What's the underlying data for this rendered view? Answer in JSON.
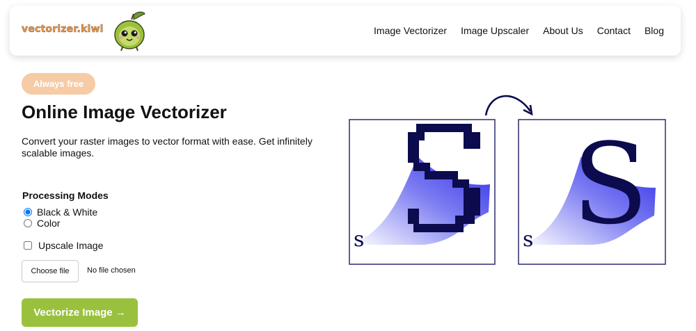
{
  "brand": {
    "logo_text": "vectorizer.kiwi",
    "mascot_icon": "kiwi-mascot-icon"
  },
  "nav": {
    "links": [
      "Image Vectorizer",
      "Image Upscaler",
      "About Us",
      "Contact",
      "Blog"
    ]
  },
  "hero": {
    "badge": "Always free",
    "title": "Online Image Vectorizer",
    "description": "Convert your raster images to vector format with ease. Get infinitely scalable images."
  },
  "form": {
    "modes_title": "Processing Modes",
    "modes": [
      {
        "label": "Black & White",
        "selected": true
      },
      {
        "label": "Color",
        "selected": false
      }
    ],
    "upscale_label": "Upscale Image",
    "upscale_checked": false,
    "file_button": "Choose file",
    "file_status": "No file chosen",
    "submit": "Vectorize Image →"
  },
  "illustration": {
    "big_letter": "S",
    "small_letter": "s",
    "raster_icon": "pixelated-s-icon",
    "vector_icon": "smooth-s-icon",
    "arrow_icon": "curved-arrow-icon"
  },
  "colors": {
    "accent_green": "#9ac13e",
    "badge_peach": "#f6cba6",
    "logo_orange": "#e79a52",
    "navy": "#0b0b4d",
    "gradient_blue": "#3a3aee"
  }
}
